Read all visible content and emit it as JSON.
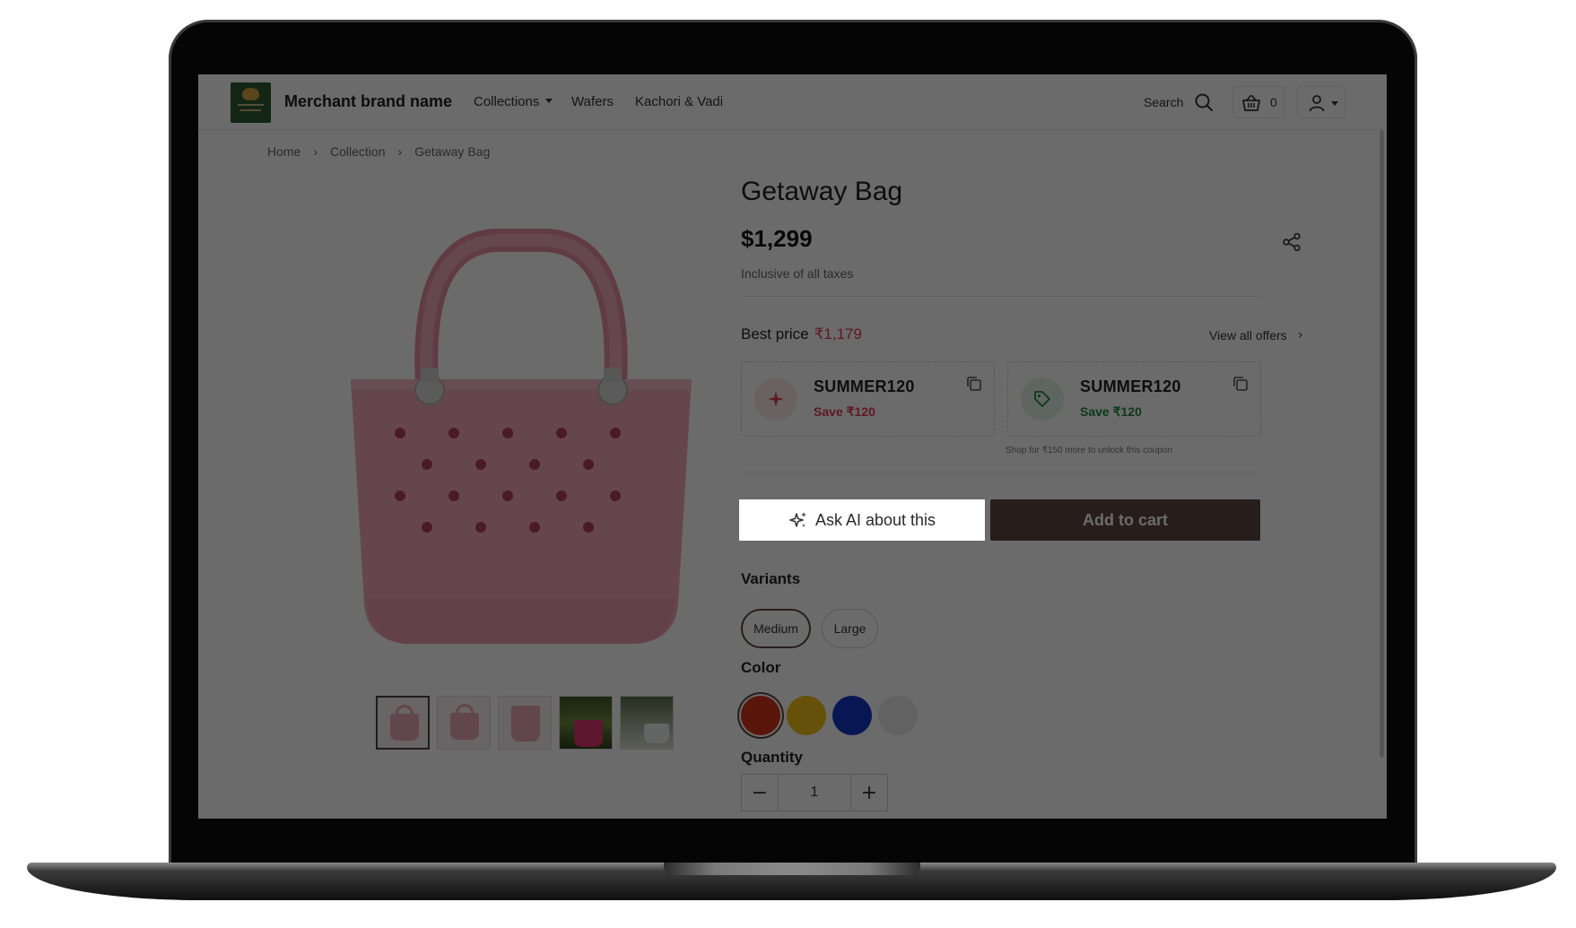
{
  "header": {
    "brand_name": "Merchant brand name",
    "nav": [
      {
        "label": "Collections",
        "has_dropdown": true
      },
      {
        "label": "Wafers"
      },
      {
        "label": "Kachori & Vadi"
      }
    ],
    "search_label": "Search",
    "cart_count": "0"
  },
  "breadcrumb": [
    "Home",
    "Collection",
    "Getaway Bag"
  ],
  "product": {
    "title": "Getaway Bag",
    "price": "$1,299",
    "tax_note": "Inclusive of all taxes",
    "best_price_label": "Best price",
    "best_price_value": "₹1,179",
    "view_offers": "View all offers",
    "coupons": [
      {
        "code": "SUMMER120",
        "save": "Save ₹120",
        "accent": "#e23a4f",
        "icon": "sparkle-icon"
      },
      {
        "code": "SUMMER120",
        "save": "Save ₹120",
        "accent": "#1f8a3b",
        "icon": "tag-icon"
      }
    ],
    "coupon_note": "Shop for ₹150 more to unlock this coupon",
    "ask_ai_label": "Ask AI about this",
    "add_to_cart_label": "Add to cart",
    "variants_label": "Variants",
    "variants": [
      {
        "label": "Medium",
        "selected": true
      },
      {
        "label": "Large",
        "selected": false
      }
    ],
    "color_label": "Color",
    "colors": [
      {
        "name": "red",
        "hex": "#d7361b",
        "selected": true
      },
      {
        "name": "yellow",
        "hex": "#f0c21a",
        "selected": false
      },
      {
        "name": "blue",
        "hex": "#1338c9",
        "selected": false
      },
      {
        "name": "light-gray",
        "hex": "#e9e9e9",
        "selected": false
      }
    ],
    "quantity_label": "Quantity",
    "quantity": "1",
    "thumbnail_count": 5,
    "bag_color": "#f2a6b9"
  },
  "theme": {
    "accent_brown": "#5d4742",
    "overlay_dim": "rgba(0,0,0,0.58)"
  }
}
